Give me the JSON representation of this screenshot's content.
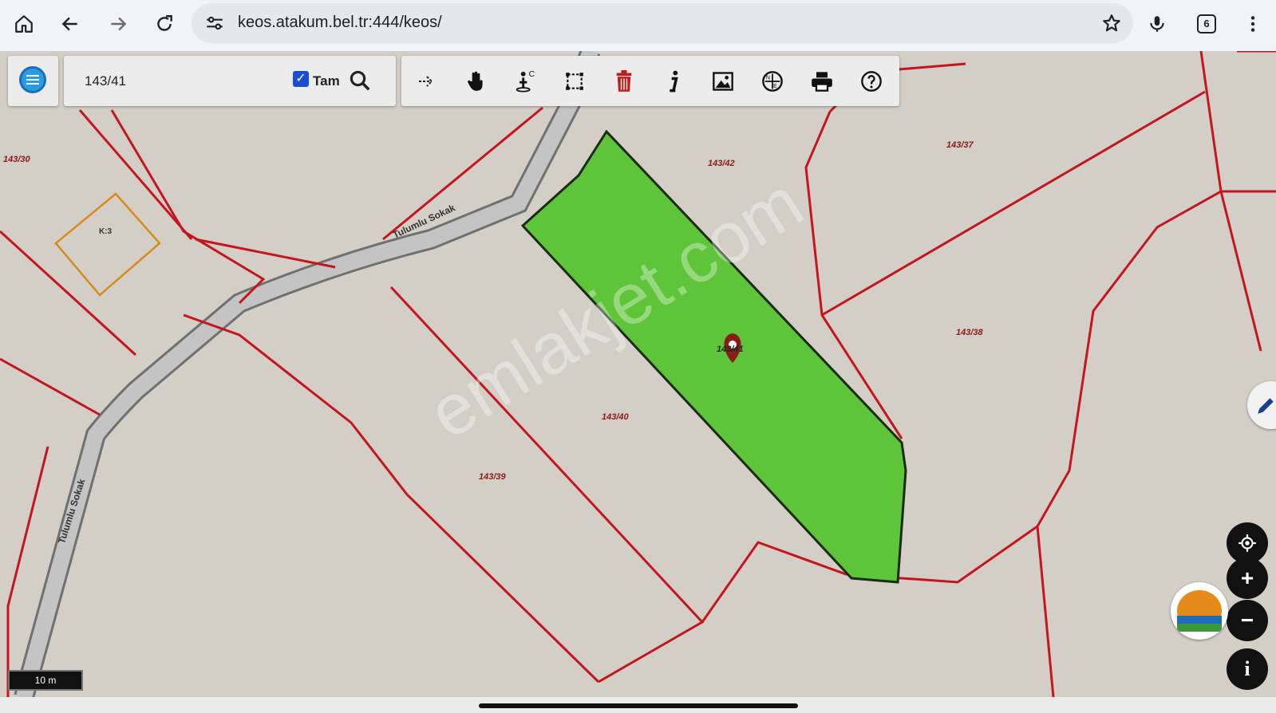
{
  "browser": {
    "url": "keos.atakum.bel.tr:444/keos/",
    "tab_count": "6"
  },
  "search": {
    "value": "143/41",
    "full_match_label": "Tam",
    "full_match_checked": true
  },
  "map": {
    "parcels": [
      {
        "label": "143/30"
      },
      {
        "label": "143/42"
      },
      {
        "label": "143/37"
      },
      {
        "label": "143/38"
      },
      {
        "label": "143/40"
      },
      {
        "label": "143/39"
      },
      {
        "label": "143/41",
        "selected": true
      }
    ],
    "building_label": "K:3",
    "street_name": "Tulumlu Sokak",
    "scale_label": "10 m",
    "watermark": "emlakjet.com",
    "colors": {
      "parcel_border": "#c4161c",
      "selected_fill": "#5ec43a",
      "road": "#b9b9b9",
      "building": "#d88a1a",
      "background": "#d3cfc6"
    }
  },
  "icons": [
    "home-icon",
    "back-icon",
    "forward-icon",
    "reload-icon",
    "tune-icon",
    "star-icon",
    "mic-icon",
    "tabs-icon",
    "more-icon",
    "menu-icon",
    "search-icon",
    "arrow-icon",
    "hand-icon",
    "measure-icon",
    "select-area-icon",
    "trash-icon",
    "info-icon",
    "image-icon",
    "coordinate-icon",
    "print-icon",
    "help-icon",
    "locate-icon",
    "zoom-in-icon",
    "zoom-out-icon",
    "info-circle-icon",
    "logo-icon"
  ],
  "controls": {
    "zoom_in": "+",
    "zoom_out": "−",
    "info": "i"
  }
}
